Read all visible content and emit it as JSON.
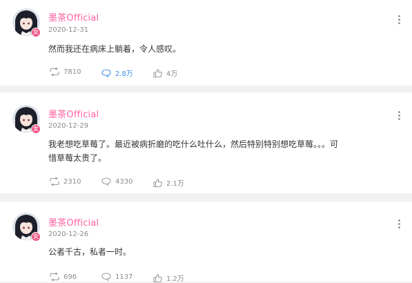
{
  "posts": [
    {
      "author": "墨茶Official",
      "badge": "女",
      "date": "2020-12-31",
      "text_lines": [
        "然而我还在病床上躺着，令人感叹。"
      ],
      "repost_count": "7810",
      "comment_count": "2.8万",
      "like_count": "4万",
      "comment_active": true
    },
    {
      "author": "墨茶Official",
      "badge": "女",
      "date": "2020-12-29",
      "text_lines": [
        "我老想吃草莓了。最近被病折磨的吃什么吐什么，然后特别特别想吃草莓。。。可",
        "惜草莓太贵了。"
      ],
      "repost_count": "2310",
      "comment_count": "4330",
      "like_count": "2.1万",
      "comment_active": false
    },
    {
      "author": "墨茶Official",
      "badge": "女",
      "date": "2020-12-26",
      "text_lines": [
        "公者千古，私者一时。"
      ],
      "repost_count": "696",
      "comment_count": "1137",
      "like_count": "1.2万",
      "comment_active": false
    }
  ],
  "colors": {
    "author": "#ff5ea0",
    "accent": "#3a8ee6",
    "muted": "#8a8a8a"
  },
  "icons": {
    "repost": "repost-icon",
    "comment": "comment-icon",
    "like": "thumbs-up-icon",
    "more": "more-vertical-icon"
  }
}
